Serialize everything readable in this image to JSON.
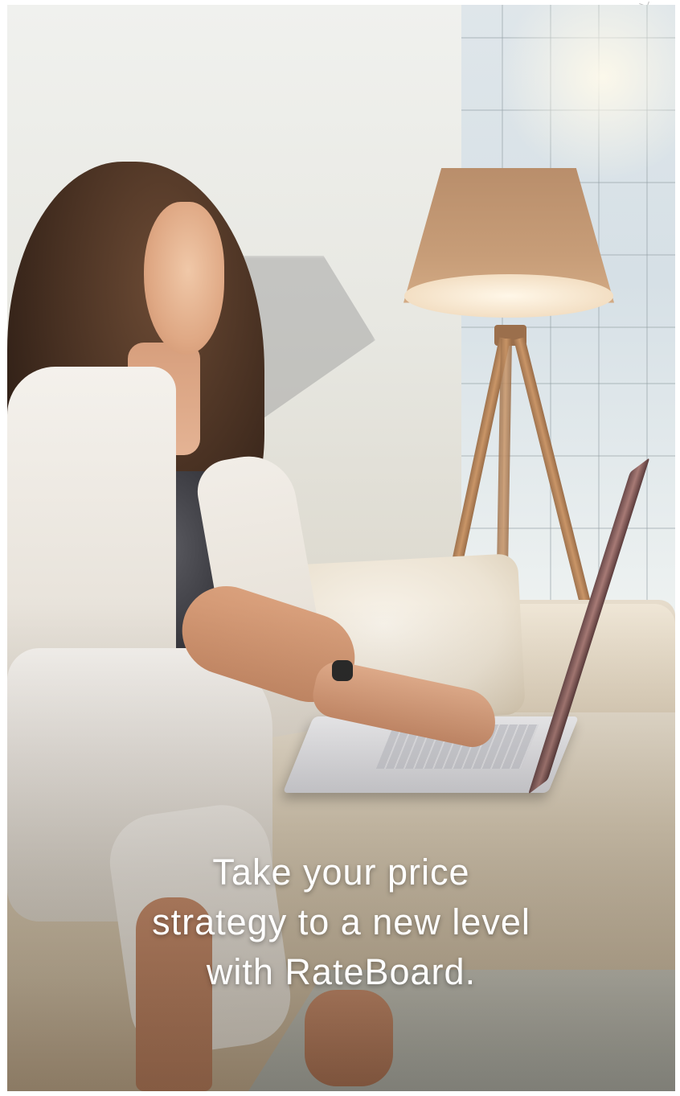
{
  "hero": {
    "caption_lines": [
      "Take your price",
      "strategy to a new level",
      "with RateBoard."
    ]
  },
  "colors": {
    "caption_text": "#ffffff",
    "lamp_shade": "#c79d78",
    "sofa": "#dccfb8"
  }
}
